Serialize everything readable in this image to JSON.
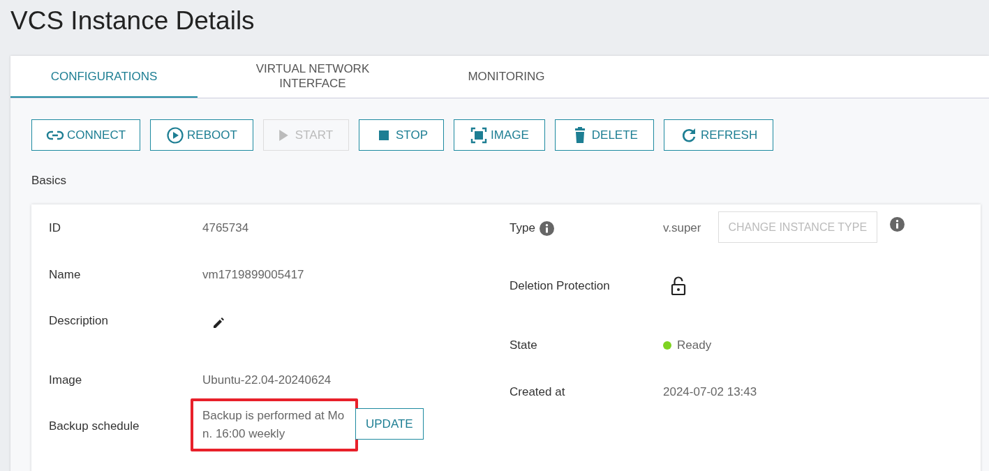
{
  "page_title": "VCS Instance Details",
  "tabs": [
    {
      "label": "CONFIGURATIONS",
      "selected": true
    },
    {
      "label": "VIRTUAL NETWORK INTERFACE",
      "selected": false
    },
    {
      "label": "MONITORING",
      "selected": false
    }
  ],
  "actions": [
    {
      "label": "CONNECT",
      "kind": "link",
      "disabled": false
    },
    {
      "label": "REBOOT",
      "kind": "reboot",
      "disabled": false
    },
    {
      "label": "START",
      "kind": "start",
      "disabled": true
    },
    {
      "label": "STOP",
      "kind": "stop",
      "disabled": false
    },
    {
      "label": "IMAGE",
      "kind": "image",
      "disabled": false
    },
    {
      "label": "DELETE",
      "kind": "delete",
      "disabled": false
    },
    {
      "label": "REFRESH",
      "kind": "refresh",
      "disabled": false
    }
  ],
  "section_title": "Basics",
  "left_fields": [
    {
      "label": "ID",
      "kind": "text",
      "value": "4765734"
    },
    {
      "label": "Name",
      "kind": "text",
      "value": "vm1719899005417"
    },
    {
      "label": "Description",
      "kind": "edit"
    },
    {
      "label": "Image",
      "kind": "text",
      "value": "Ubuntu-22.04-20240624"
    },
    {
      "label": "Backup schedule",
      "kind": "backup",
      "value": "Backup is performed at Mon. 16:00 weekly",
      "button": "UPDATE",
      "highlighted": true
    }
  ],
  "right_fields": [
    {
      "label": "Type",
      "kind": "type",
      "info": true,
      "value": "v.super",
      "button": {
        "label": "CHANGE INSTANCE TYPE",
        "disabled": true
      }
    },
    {
      "label": "Deletion Protection",
      "kind": "lock",
      "locked": false
    },
    {
      "label": "State",
      "kind": "state",
      "value": "Ready",
      "color": "#7ed321"
    },
    {
      "label": "Created at",
      "kind": "text",
      "value": "2024-07-02 13:43"
    }
  ]
}
